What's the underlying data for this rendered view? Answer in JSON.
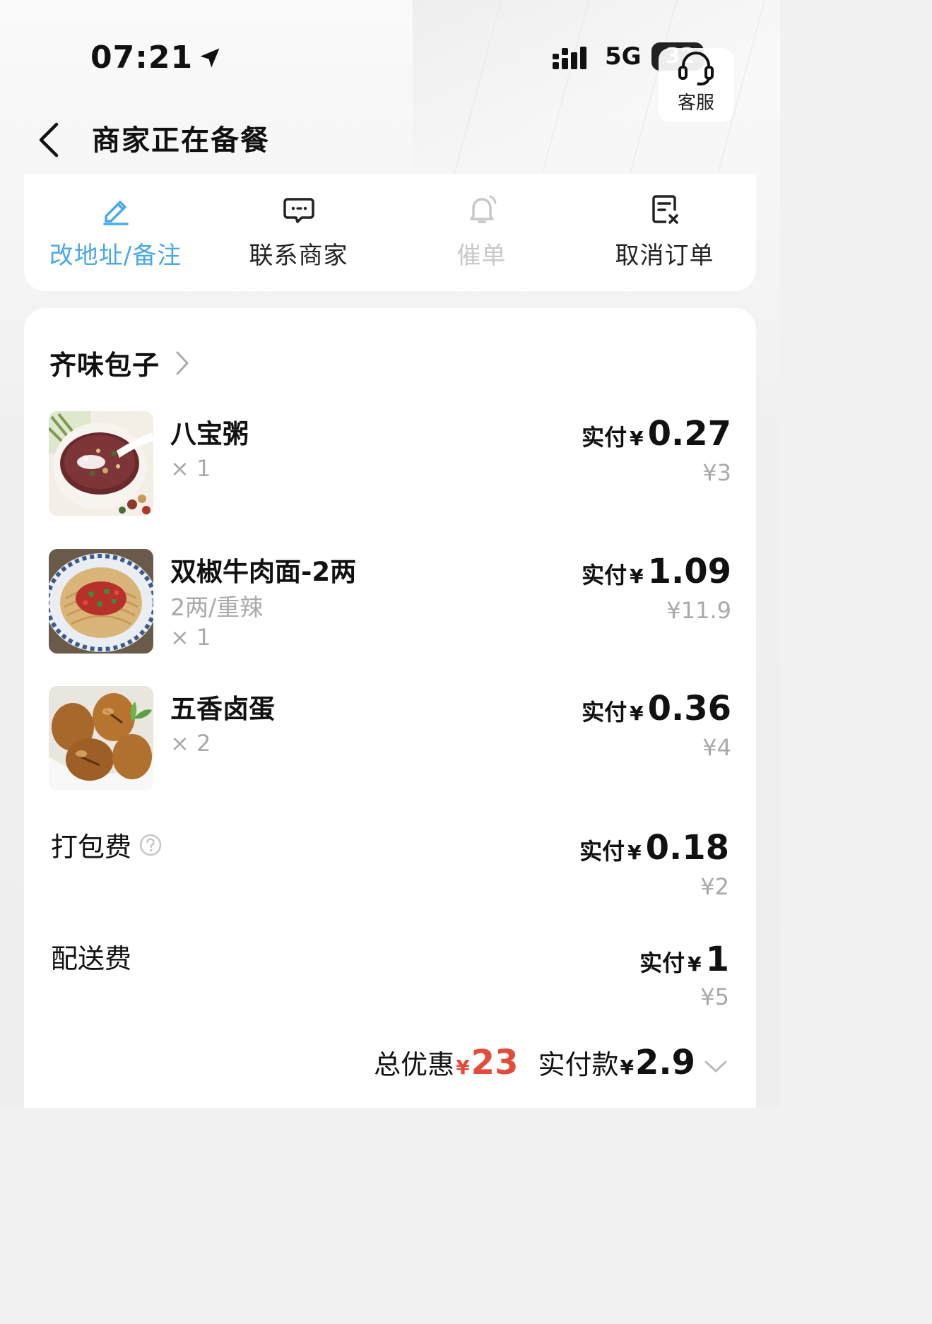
{
  "status_bar": {
    "time": "07:21",
    "network": "5G",
    "battery": "32"
  },
  "service": {
    "label": "客服"
  },
  "header": {
    "title": "商家正在备餐"
  },
  "actions": [
    {
      "label": "改地址/备注",
      "icon": "edit-icon",
      "state": "active",
      "color": "#4aa9e9"
    },
    {
      "label": "联系商家",
      "icon": "chat-icon",
      "state": "normal"
    },
    {
      "label": "催单",
      "icon": "bell-icon",
      "state": "disabled"
    },
    {
      "label": "取消订单",
      "icon": "cancel-order-icon",
      "state": "normal"
    }
  ],
  "order": {
    "shop_name": "齐味包子",
    "items": [
      {
        "name": "八宝粥",
        "spec": "",
        "qty": "× 1",
        "paid_label": "实付",
        "currency": "¥",
        "paid": "0.27",
        "original": "¥3"
      },
      {
        "name": "双椒牛肉面-2两",
        "spec": "2两/重辣",
        "qty": "× 1",
        "paid_label": "实付",
        "currency": "¥",
        "paid": "1.09",
        "original": "¥11.9"
      },
      {
        "name": "五香卤蛋",
        "spec": "",
        "qty": "× 2",
        "paid_label": "实付",
        "currency": "¥",
        "paid": "0.36",
        "original": "¥4"
      }
    ],
    "fees": [
      {
        "name": "打包费",
        "paid_label": "实付",
        "currency": "¥",
        "paid": "0.18",
        "original": "¥2",
        "help_icon": "question-circle-icon"
      },
      {
        "name": "配送费",
        "paid_label": "实付",
        "currency": "¥",
        "paid": "1",
        "original": "¥5"
      }
    ],
    "summary": {
      "discount_label": "总优惠",
      "discount_currency": "¥",
      "discount": "23",
      "paid_label": "实付款",
      "paid_currency": "¥",
      "paid": "2.9",
      "accent": "#e34b3a"
    }
  }
}
